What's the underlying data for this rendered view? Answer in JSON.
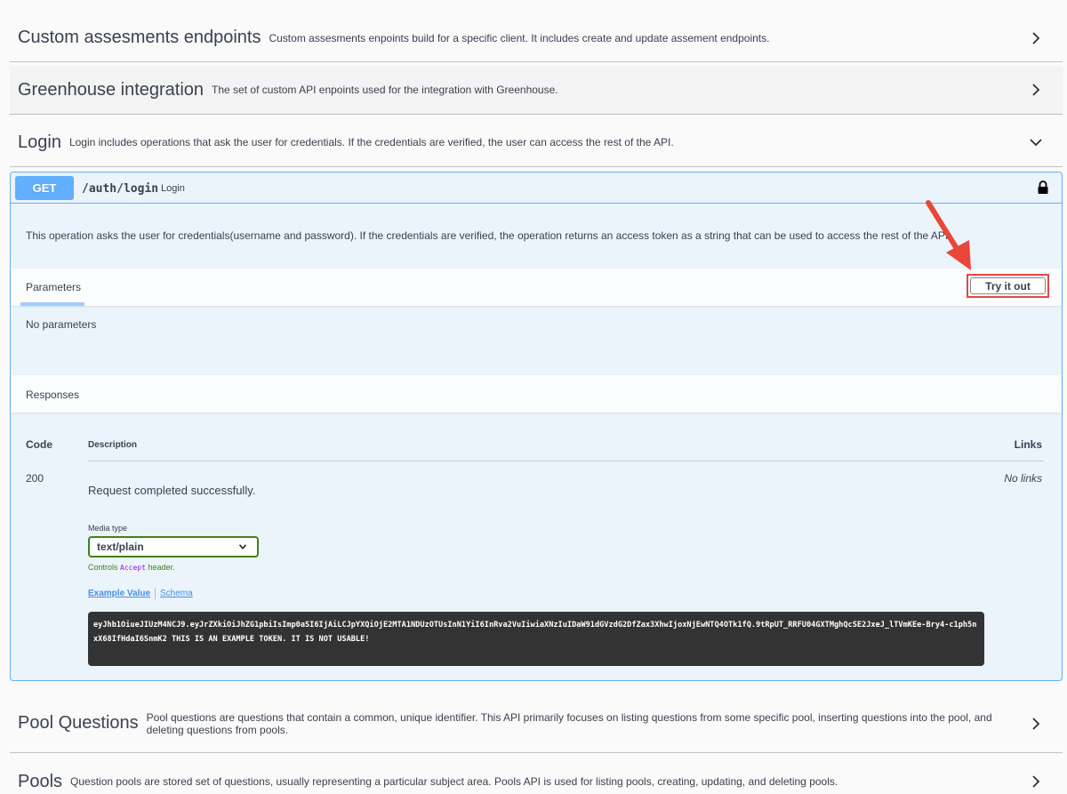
{
  "tags": [
    {
      "title": "Custom assesments endpoints",
      "desc": "Custom assesments enpoints build for a specific client. It includes create and update assement endpoints.",
      "chevron": "chevron-right"
    },
    {
      "title": "Greenhouse integration",
      "desc": "The set of custom API enpoints used for the integration with Greenhouse.",
      "chevron": "chevron-right"
    },
    {
      "title": "Login",
      "desc": "Login includes operations that ask the user for credentials. If the credentials are verified, the user can access the rest of the API.",
      "chevron": "chevron-down"
    },
    {
      "title": "Pool Questions",
      "desc": "Pool questions are questions that contain a common, unique identifier. This API primarily focuses on listing questions from some specific pool, inserting questions into the pool, and deleting questions from pools.",
      "chevron": "chevron-right"
    },
    {
      "title": "Pools",
      "desc": "Question pools are stored set of questions, usually representing a particular subject area. Pools API is used for listing pools, creating, updating, and deleting pools.",
      "chevron": "chevron-right"
    }
  ],
  "operation": {
    "method": "GET",
    "path": "/auth/login",
    "summary": "Login",
    "description": "This operation asks the user for credentials(username and password). If the credentials are verified, the operation returns an access token as a string that can be used to access the rest of the API.",
    "parameters_tab": "Parameters",
    "try_it_out": "Try it out",
    "no_parameters": "No parameters",
    "responses_label": "Responses",
    "columns": {
      "code": "Code",
      "description": "Description",
      "links": "Links"
    },
    "response": {
      "code": "200",
      "description": "Request completed successfully.",
      "links": "No links",
      "media_type_label": "Media type",
      "media_type": "text/plain",
      "controls_prefix": "Controls",
      "controls_code": "Accept",
      "controls_suffix": "header.",
      "example_tab": "Example Value",
      "schema_tab": "Schema",
      "example": "eyJhb1OiueJIUzM4NCJ9.eyJrZXkiOiJhZG1pbiIsImp0aSI6IjAiLCJpYXQiOjE2MTA1NDUzOTUsInN1YiI6InRva2VuIiwiaXNzIuIDaW91dGVzdG2DfZax3XhwIjoxNjEwNTQ4OTk1fQ.9tRpUT_RRFU04GXTMghQcSE2JxeJ_lTVmKEe-Bry4-c1ph5nxX68IfHdaI6SnmK2 THIS IS AN EXAMPLE TOKEN. IT IS NOT USABLE!"
    }
  },
  "colors": {
    "get_blue": "#61affe",
    "op_bg": "#ebf3fb",
    "highlight_red": "#de4a46",
    "valid_green": "#41811e",
    "text": "#3b4151"
  }
}
